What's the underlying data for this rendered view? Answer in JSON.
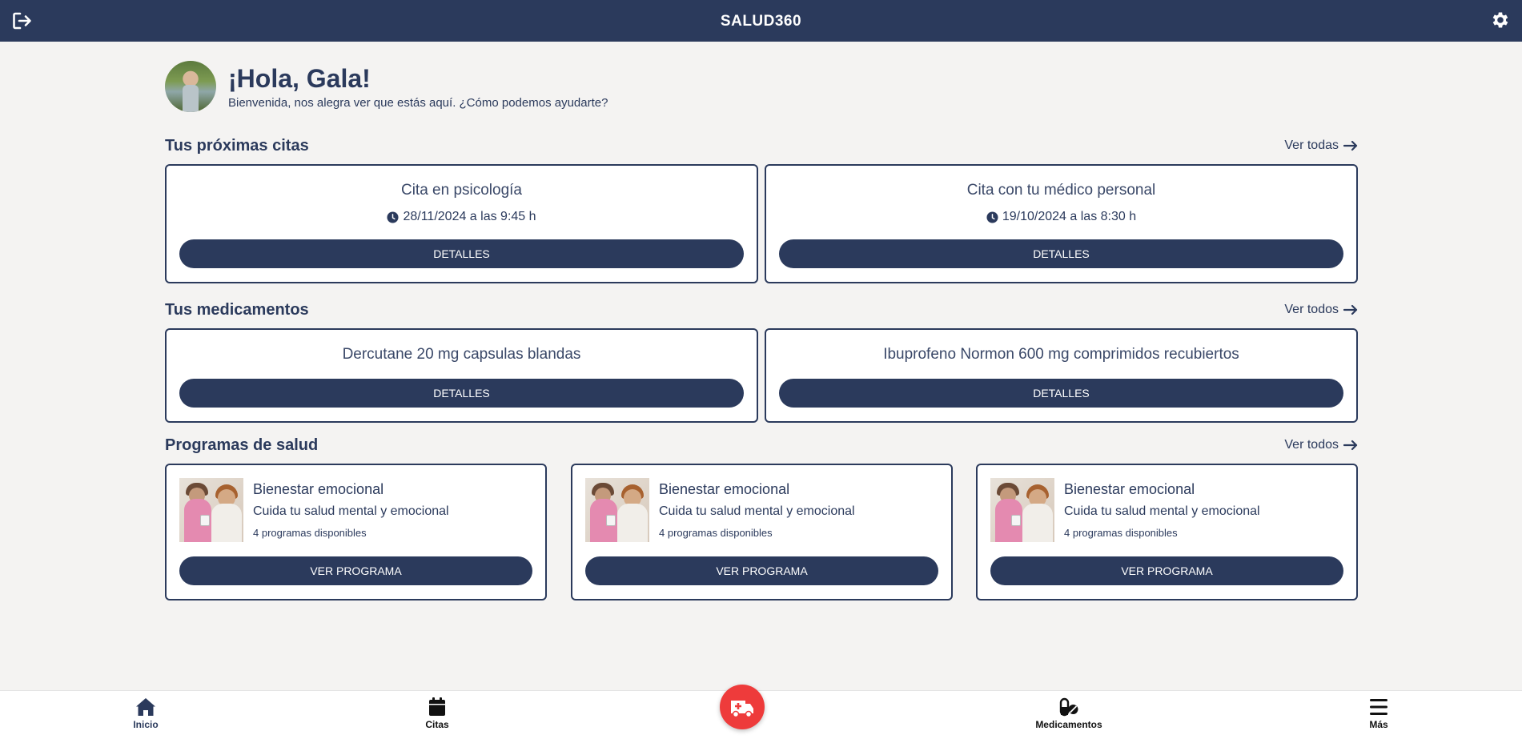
{
  "app": {
    "title": "SALUD360"
  },
  "greeting": {
    "hello": "¡Hola, Gala!",
    "welcome": "Bienvenida, nos alegra ver que estás aquí. ¿Cómo podemos ayudarte?"
  },
  "appointments": {
    "title": "Tus próximas citas",
    "see_all": "Ver todas",
    "items": [
      {
        "name": "Cita en psicología",
        "time": "28/11/2024 a las 9:45 h",
        "button": "DETALLES"
      },
      {
        "name": "Cita con tu médico personal",
        "time": "19/10/2024 a las 8:30 h",
        "button": "DETALLES"
      }
    ]
  },
  "medications": {
    "title": "Tus medicamentos",
    "see_all": "Ver todos",
    "items": [
      {
        "name": "Dercutane 20 mg capsulas blandas",
        "button": "DETALLES"
      },
      {
        "name": "Ibuprofeno Normon 600 mg comprimidos recubiertos",
        "button": "DETALLES"
      }
    ]
  },
  "programs": {
    "title": "Programas de salud",
    "see_all": "Ver todos",
    "items": [
      {
        "title": "Bienestar emocional",
        "subtitle": "Cuida tu salud mental y emocional",
        "count": "4 programas disponibles",
        "button": "VER PROGRAMA"
      },
      {
        "title": "Bienestar emocional",
        "subtitle": "Cuida tu salud mental y emocional",
        "count": "4 programas disponibles",
        "button": "VER PROGRAMA"
      },
      {
        "title": "Bienestar emocional",
        "subtitle": "Cuida tu salud mental y emocional",
        "count": "4 programas disponibles",
        "button": "VER PROGRAMA"
      }
    ]
  },
  "bottom_nav": {
    "items": [
      {
        "label": "Inicio",
        "icon": "home-icon"
      },
      {
        "label": "Citas",
        "icon": "calendar-icon"
      },
      {
        "label": "Medicamentos",
        "icon": "pills-icon"
      },
      {
        "label": "Más",
        "icon": "menu-icon"
      }
    ],
    "center_icon": "ambulance-icon"
  },
  "colors": {
    "primary": "#2b3a5c",
    "background": "#f4f3f2",
    "emergency": "#ee3b3b"
  }
}
